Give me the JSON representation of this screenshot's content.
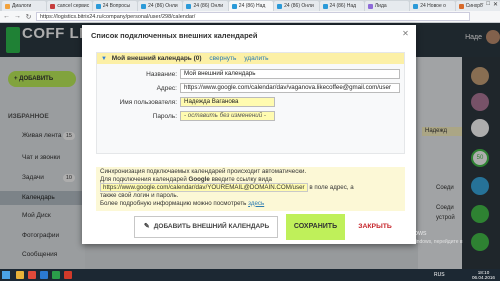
{
  "browser": {
    "tabs": [
      {
        "label": "Диалоги",
        "color": "#f2a23c"
      },
      {
        "label": "cancel сервис",
        "color": "#c63d3d"
      },
      {
        "label": "24 Вопросы",
        "color": "#2b9ad8"
      },
      {
        "label": "24 (86) Онли",
        "color": "#2b9ad8"
      },
      {
        "label": "24 (86) Онли",
        "color": "#2b9ad8"
      },
      {
        "label": "24 (86) Над",
        "color": "#2b9ad8",
        "active": true
      },
      {
        "label": "24 (86) Онли",
        "color": "#2b9ad8"
      },
      {
        "label": "24 (86) Над",
        "color": "#2b9ad8"
      },
      {
        "label": "Лида",
        "color": "#8e6bd8"
      },
      {
        "label": "24 Новое о",
        "color": "#2b9ad8"
      },
      {
        "label": "Синхро",
        "color": "#d86a2b"
      }
    ],
    "url": "https://logistics.bitrix24.ru/company/personal/user/298/calendar/"
  },
  "app": {
    "logo": "COFF LIKE",
    "user_name": "Наде"
  },
  "sidebar": {
    "add_label": "+ ДОБАВИТЬ",
    "section": "ИЗБРАННОЕ",
    "items": [
      {
        "label": "Живая лента",
        "count": "15"
      },
      {
        "label": "Чат и звонки",
        "count": ""
      },
      {
        "label": "Задачи",
        "count": "10"
      },
      {
        "label": "Календарь",
        "count": "",
        "active": true
      },
      {
        "label": "Мой Диск",
        "count": ""
      },
      {
        "label": "Фотографии",
        "count": ""
      },
      {
        "label": "Сообщения",
        "count": ""
      }
    ]
  },
  "right_panel": {
    "user_chip": "Надежд",
    "item1": "Соеди",
    "item2": "Соеди",
    "item3": "устрой",
    "badge": "50"
  },
  "modal": {
    "title": "Список подключенных внешних календарей",
    "calendar": {
      "name_heading": "Мой внешний календарь (0)",
      "collapse_link": "свернуть",
      "delete_link": "удалить",
      "fields": {
        "name_label": "Название:",
        "name_value": "Мой внешний календарь",
        "address_label": "Адрес:",
        "address_value": "https://www.google.com/calendar/dav/vaganova.likecoffee@gmail.com/user",
        "username_label": "Имя пользователя:",
        "username_value": "Надежда Ваганова",
        "password_label": "Пароль:",
        "password_value": "- оставить без изменений -"
      }
    },
    "info": {
      "line1": "Синхронизация подключаемых календарей происходит автоматически.",
      "line2_pre": "Для подключения календарей",
      "line2_brand": "Google",
      "line2_post": "введите ссылку вида",
      "url_example": "https://www.google.com/calendar/dav/YOUREMAIL@DOMAIN.COM/user",
      "line3_post": "в поле адрес, а",
      "line4": "также свой логин и пароль.",
      "line5_pre": "Более подробную информацию можно посмотреть",
      "line5_link": "здесь"
    },
    "buttons": {
      "add": "ДОБАВИТЬ ВНЕШНИЙ КАЛЕНДАРЬ",
      "save": "СОХРАНИТЬ",
      "close": "ЗАКРЫТЬ"
    }
  },
  "watermark": {
    "line1": "Активация Windows",
    "line2": "Чтобы активировать Windows, перейдите в"
  },
  "taskbar": {
    "lang": "RUS",
    "time": "18:10",
    "date": "06.04.2016"
  }
}
